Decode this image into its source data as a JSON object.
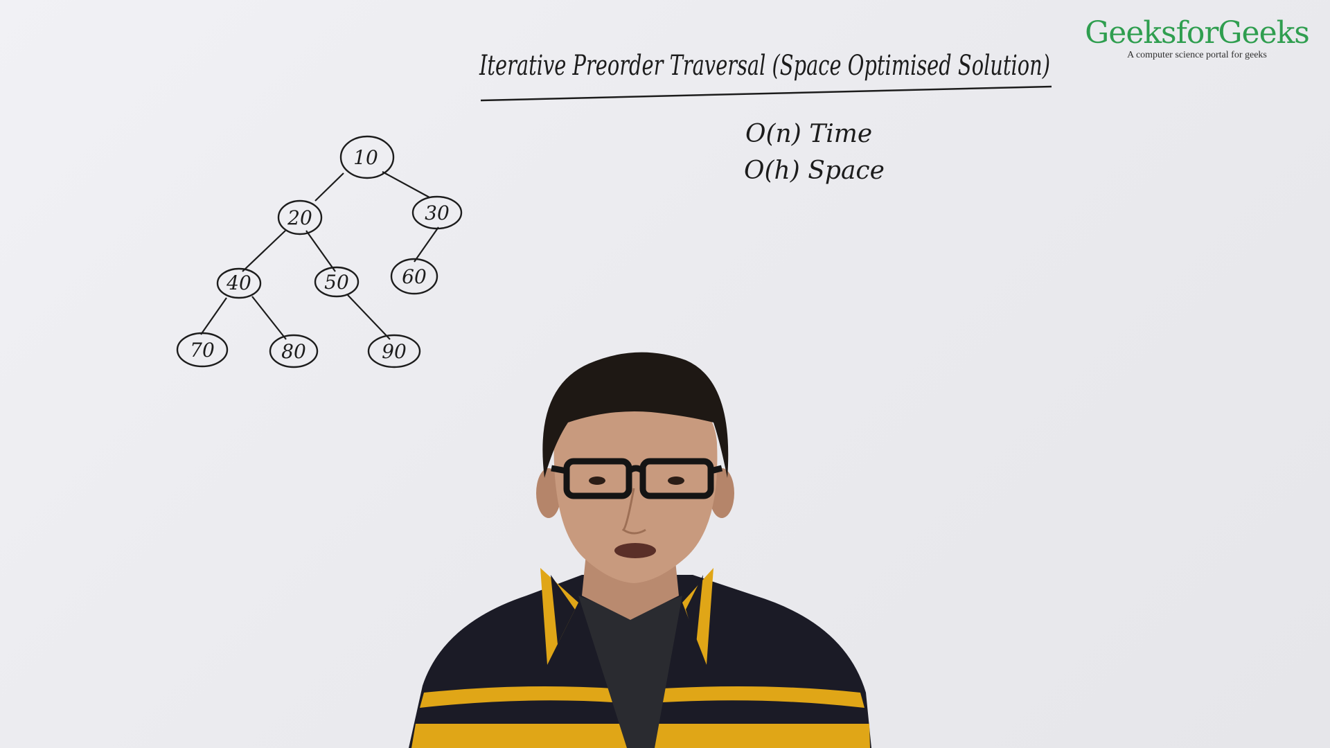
{
  "whiteboard": {
    "title": "Iterative Preorder Traversal (Space Optimised Solution)",
    "complexity": {
      "time": "O(n) Time",
      "space": "O(h) Space"
    }
  },
  "tree": {
    "nodes": [
      "10",
      "20",
      "30",
      "40",
      "50",
      "60",
      "70",
      "80",
      "90"
    ],
    "edges": [
      [
        "10",
        "20"
      ],
      [
        "10",
        "30"
      ],
      [
        "20",
        "40"
      ],
      [
        "20",
        "50"
      ],
      [
        "30",
        "60"
      ],
      [
        "40",
        "70"
      ],
      [
        "40",
        "80"
      ],
      [
        "50",
        "90"
      ]
    ]
  },
  "brand": {
    "name": "GeeksforGeeks",
    "tagline": "A computer science portal for geeks",
    "color": "#2f9e4f"
  },
  "presenter": {
    "sweater_colors": [
      "#1b1b26",
      "#e0a617"
    ]
  }
}
